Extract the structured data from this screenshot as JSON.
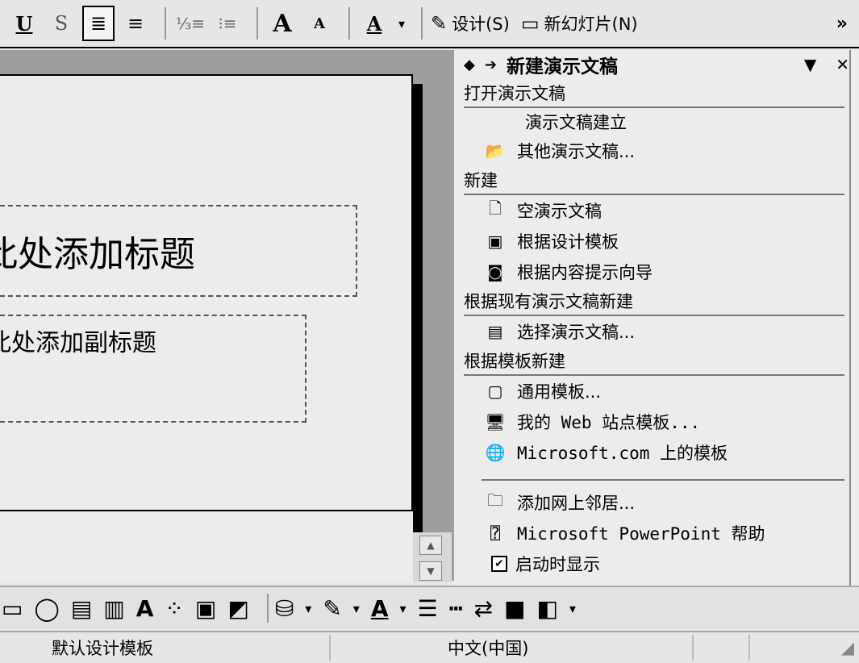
{
  "toolbar": {
    "underline": "U",
    "shadow": "S",
    "align_left_icon": "align-left-icon",
    "center_icon": "center-icon",
    "numbering": "⅓≡",
    "bullets": "⁝≡",
    "font_increase": "A",
    "font_decrease": "A",
    "font_color": "A",
    "design_label": "设计(S)",
    "new_slide_label": "新幻灯片(N)",
    "more": "»"
  },
  "slide": {
    "title_placeholder": "此处添加标题",
    "subtitle_placeholder": "此处添加副标题"
  },
  "pane": {
    "title": "新建演示文稿",
    "sections": {
      "open": "打开演示文稿",
      "new": "新建",
      "existing": "根据现有演示文稿新建",
      "template": "根据模板新建"
    },
    "items": {
      "create_presentation": "演示文稿建立",
      "other_presentations": "其他演示文稿...",
      "blank": "空演示文稿",
      "from_design": "根据设计模板",
      "from_wizard": "根据内容提示向导",
      "choose": "选择演示文稿...",
      "general": "通用模板...",
      "web_templates": "我的 Web 站点模板...",
      "ms_templates": "Microsoft.com 上的模板",
      "add_network": "添加网上邻居...",
      "help": "Microsoft PowerPoint 帮助",
      "show_on_start": "启动时显示"
    }
  },
  "status": {
    "template": "默认设计模板",
    "language": "中文(中国)"
  }
}
